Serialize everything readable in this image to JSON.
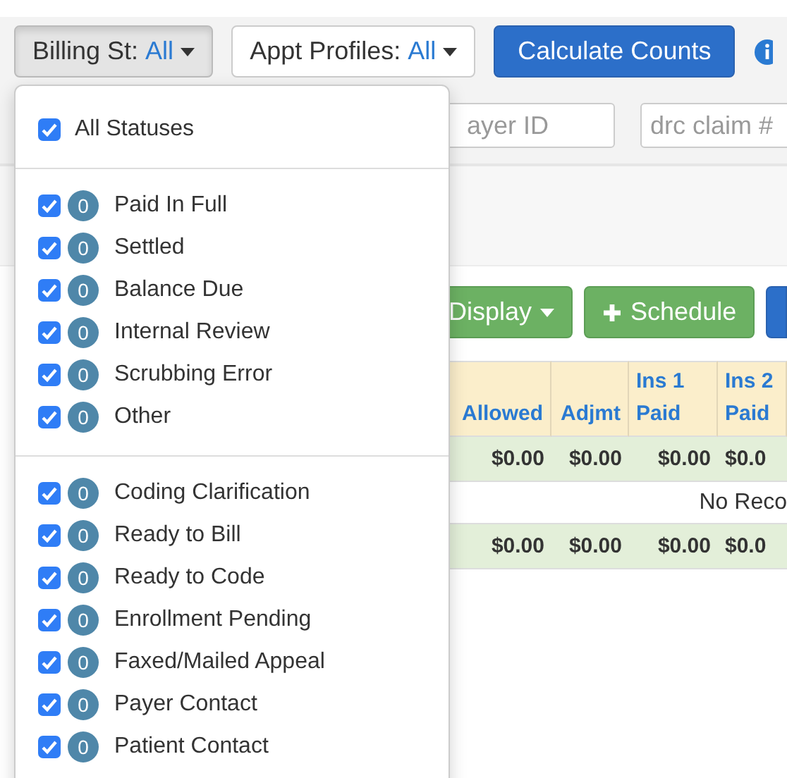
{
  "toolbar": {
    "billing_status": {
      "label": "Billing St:",
      "value": "All",
      "expanded": true
    },
    "appt_profiles": {
      "label": "Appt Profiles:",
      "value": "All"
    },
    "calculate_button": "Calculate Counts"
  },
  "filters": [
    {
      "placeholder": "ayer ID"
    },
    {
      "placeholder": "drc claim #"
    }
  ],
  "actions": [
    {
      "kind": "dropdown",
      "label": "Display"
    },
    {
      "kind": "add",
      "label": "Schedule"
    },
    {
      "kind": "blank"
    }
  ],
  "table": {
    "columns": [
      "Allowed",
      "Adjmt",
      "Ins 1 Paid",
      "Ins 2 Paid"
    ],
    "rows": [
      {
        "kind": "summary",
        "cells": [
          "$0.00",
          "$0.00",
          "$0.00",
          "$0.0"
        ]
      },
      {
        "kind": "message",
        "text": "No Reco"
      },
      {
        "kind": "summary",
        "cells": [
          "$0.00",
          "$0.00",
          "$0.00",
          "$0.0"
        ]
      }
    ]
  },
  "status_menu": {
    "all": {
      "label": "All Statuses",
      "checked": true
    },
    "groups": [
      [
        {
          "label": "Paid In Full",
          "count": "0",
          "checked": true
        },
        {
          "label": "Settled",
          "count": "0",
          "checked": true
        },
        {
          "label": "Balance Due",
          "count": "0",
          "checked": true
        },
        {
          "label": "Internal Review",
          "count": "0",
          "checked": true
        },
        {
          "label": "Scrubbing Error",
          "count": "0",
          "checked": true
        },
        {
          "label": "Other",
          "count": "0",
          "checked": true
        }
      ],
      [
        {
          "label": "Coding Clarification",
          "count": "0",
          "checked": true
        },
        {
          "label": "Ready to Bill",
          "count": "0",
          "checked": true
        },
        {
          "label": "Ready to Code",
          "count": "0",
          "checked": true
        },
        {
          "label": "Enrollment Pending",
          "count": "0",
          "checked": true
        },
        {
          "label": "Faxed/Mailed Appeal",
          "count": "0",
          "checked": true
        },
        {
          "label": "Payer Contact",
          "count": "0",
          "checked": true
        },
        {
          "label": "Patient Contact",
          "count": "0",
          "checked": true
        }
      ]
    ]
  }
}
